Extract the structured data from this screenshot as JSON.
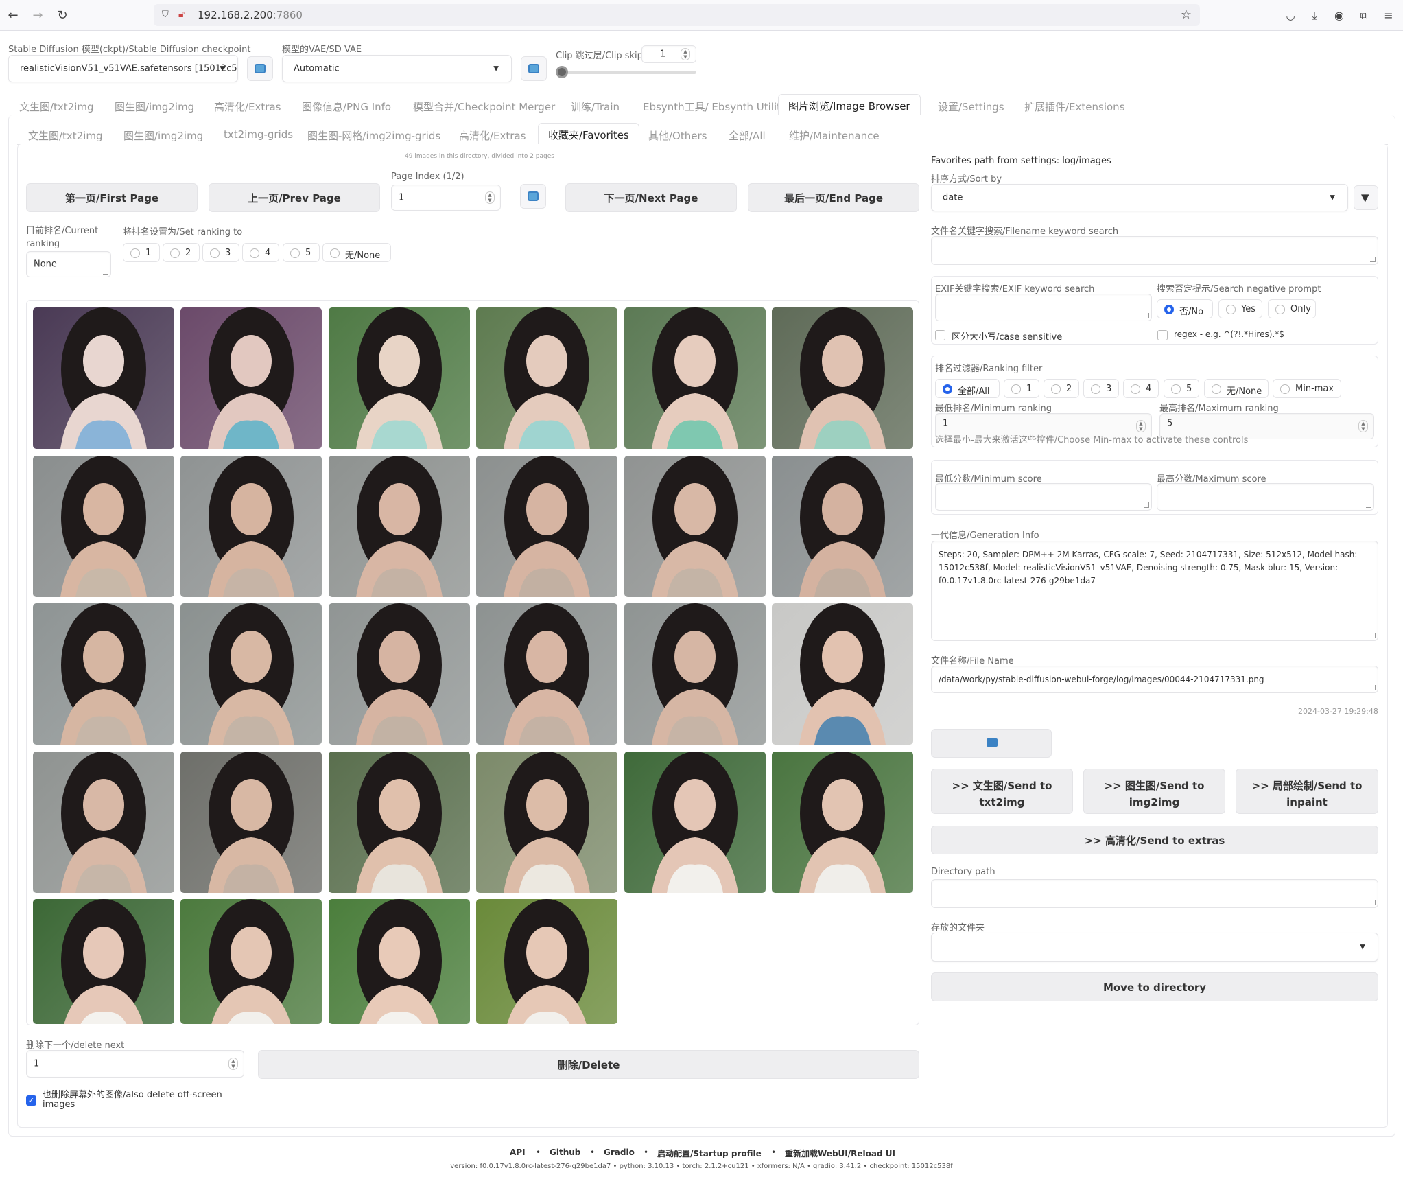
{
  "browser": {
    "url_host": "192.168.2.200",
    "url_port": ":7860"
  },
  "top": {
    "checkpoint_label": "Stable Diffusion 模型(ckpt)/Stable Diffusion checkpoint",
    "checkpoint_value": "realisticVisionV51_v51VAE.safetensors [15012c5",
    "vae_label": "模型的VAE/SD VAE",
    "vae_value": "Automatic",
    "clip_label": "Clip 跳过层/Clip skip",
    "clip_value": "1",
    "clip_slider_fraction": 0.0
  },
  "main_tabs": [
    "文生图/txt2img",
    "图生图/img2img",
    "高清化/Extras",
    "图像信息/PNG Info",
    "模型合并/Checkpoint Merger",
    "训练/Train",
    "Ebsynth工具/ Ebsynth Utility",
    "图片浏览/Image Browser",
    "设置/Settings",
    "扩展插件/Extensions"
  ],
  "main_active": 7,
  "sub_tabs": [
    "文生图/txt2img",
    "图生图/img2img",
    "txt2img-grids",
    "图生图-网格/img2img-grids",
    "高清化/Extras",
    "收藏夹/Favorites",
    "其他/Others",
    "全部/All",
    "维护/Maintenance"
  ],
  "sub_active": 5,
  "gallery": {
    "info": "49 images in this directory, divided into 2 pages",
    "page_index_label": "Page Index (1/2)",
    "page_index_value": "1",
    "first_page": "第一页/First Page",
    "prev_page": "上一页/Prev Page",
    "next_page": "下一页/Next Page",
    "end_page": "最后一页/End Page",
    "current_ranking_label": "目前排名/Current ranking",
    "current_ranking_value": "None",
    "set_ranking_label": "将排名设置为/Set ranking to",
    "ranking_options": [
      "1",
      "2",
      "3",
      "4",
      "5",
      "无/None"
    ],
    "delete_next_label": "删除下一个/delete next",
    "delete_next_value": "1",
    "delete_button": "删除/Delete",
    "also_delete_label": "也删除屏幕外的图像/also delete off-screen images",
    "also_delete_checked": true
  },
  "thumbs": [
    {
      "bg": "#4a3a55",
      "fg": "#e8d6d0",
      "accent": "#8ab4d8"
    },
    {
      "bg": "#6b4a6a",
      "fg": "#e2c8c0",
      "accent": "#6fb6c8"
    },
    {
      "bg": "#4f7a45",
      "fg": "#e8d4c6",
      "accent": "#a8d8d0"
    },
    {
      "bg": "#5e7b50",
      "fg": "#e4cbbd",
      "accent": "#9fd4d0"
    },
    {
      "bg": "#5c7a55",
      "fg": "#e6ccbe",
      "accent": "#7fc8b0"
    },
    {
      "bg": "#5f6b58",
      "fg": "#e0c2b2",
      "accent": "#9dd0c0"
    },
    {
      "bg": "#8a8e8e",
      "fg": "#d8b6a2",
      "accent": "#c8b8a8"
    },
    {
      "bg": "#8f9393",
      "fg": "#d6b4a0",
      "accent": "#c6b4a6"
    },
    {
      "bg": "#8e9290",
      "fg": "#d8b6a4",
      "accent": "#c4b2a4"
    },
    {
      "bg": "#8c908f",
      "fg": "#d6b4a2",
      "accent": "#c2b0a2"
    },
    {
      "bg": "#909392",
      "fg": "#d8b8a6",
      "accent": "#c4b4a6"
    },
    {
      "bg": "#8a8f90",
      "fg": "#d4b2a0",
      "accent": "#c0aea0"
    },
    {
      "bg": "#8e9494",
      "fg": "#d6b6a2",
      "accent": "#c6b6a8"
    },
    {
      "bg": "#8b9190",
      "fg": "#d8b8a4",
      "accent": "#c4b4a6"
    },
    {
      "bg": "#909594",
      "fg": "#d6b4a2",
      "accent": "#c2b2a4"
    },
    {
      "bg": "#8d9291",
      "fg": "#d8b6a4",
      "accent": "#c4b2a4"
    },
    {
      "bg": "#8f9493",
      "fg": "#d6b6a4",
      "accent": "#c6b4a6"
    },
    {
      "bg": "#c8c8c6",
      "fg": "#e2c2b0",
      "accent": "#5a8ab0"
    },
    {
      "bg": "#8f9391",
      "fg": "#d8b8a6",
      "accent": "#c6b6a8"
    },
    {
      "bg": "#6e6f6a",
      "fg": "#d8b8a4",
      "accent": "#c4b2a4"
    },
    {
      "bg": "#5a6f4e",
      "fg": "#e0c0ac",
      "accent": "#e8e4dc"
    },
    {
      "bg": "#7c8a6a",
      "fg": "#dcbca8",
      "accent": "#ece8e0"
    },
    {
      "bg": "#3f6a3a",
      "fg": "#e4c6b6",
      "accent": "#f2f0ec"
    },
    {
      "bg": "#4a7540",
      "fg": "#e2c4b2",
      "accent": "#f0eeea"
    },
    {
      "bg": "#3c6836",
      "fg": "#e6c8b8",
      "accent": "#f4f2ee"
    },
    {
      "bg": "#4c7a3e",
      "fg": "#e4c6b4",
      "accent": "#f2f0ec"
    },
    {
      "bg": "#4b7e3c",
      "fg": "#e8cab8",
      "accent": "#f4f2ee"
    },
    {
      "bg": "#6a8a3a",
      "fg": "#e6c8b6",
      "accent": "#f2f0ec"
    }
  ],
  "right": {
    "favorites_path": "Favorites path from settings: log/images",
    "sort_label": "排序方式/Sort by",
    "sort_value": "date",
    "filename_search_label": "文件名关键字搜索/Filename keyword search",
    "exif_label": "EXIF关键字搜索/EXIF keyword search",
    "negative_label": "搜索否定提示/Search negative prompt",
    "negative_options": [
      "否/No",
      "Yes",
      "Only"
    ],
    "negative_selected": 0,
    "case_sensitive": "区分大小写/case sensitive",
    "regex": "regex - e.g. ^(?!.*Hires).*$",
    "ranking_filter_label": "排名过滤器/Ranking filter",
    "ranking_filter_options": [
      "全部/All",
      "1",
      "2",
      "3",
      "4",
      "5",
      "无/None",
      "Min-max"
    ],
    "ranking_filter_selected": 0,
    "min_ranking_label": "最低排名/Minimum ranking",
    "min_ranking_value": "1",
    "max_ranking_label": "最高排名/Maximum ranking",
    "max_ranking_value": "5",
    "minmax_hint": "选择最小-最大来激活这些控件/Choose Min-max to activate these controls",
    "min_score_label": "最低分数/Minimum score",
    "max_score_label": "最高分数/Maximum score",
    "gen_info_label": "一代信息/Generation Info",
    "gen_info": "Steps: 20, Sampler: DPM++ 2M Karras, CFG scale: 7, Seed: 2104717331, Size: 512x512, Model hash: 15012c538f, Model: realisticVisionV51_v51VAE, Denoising strength: 0.75, Mask blur: 15, Version: f0.0.17v1.8.0rc-latest-276-g29be1da7",
    "file_name_label": "文件名称/File Name",
    "file_name": "/data/work/py/stable-diffusion-webui-forge/log/images/00044-2104717331.png",
    "timestamp": "2024-03-27 19:29:48",
    "send_txt2img": ">> 文生图/Send to txt2img",
    "send_img2img": ">> 图生图/Send to img2img",
    "send_inpaint": ">> 局部绘制/Send to inpaint",
    "send_extras": ">> 高清化/Send to extras",
    "directory_path_label": "Directory path",
    "folder_label": "存放的文件夹",
    "move_button": "Move to directory"
  },
  "footer": {
    "links": [
      "API",
      "Github",
      "Gradio",
      "启动配置/Startup profile",
      "重新加载WebUI/Reload UI"
    ],
    "version_line": "version: f0.0.17v1.8.0rc-latest-276-g29be1da7  •  python: 3.10.13  •  torch: 2.1.2+cu121  •  xformers: N/A  •  gradio: 3.41.2  •  checkpoint: 15012c538f"
  }
}
